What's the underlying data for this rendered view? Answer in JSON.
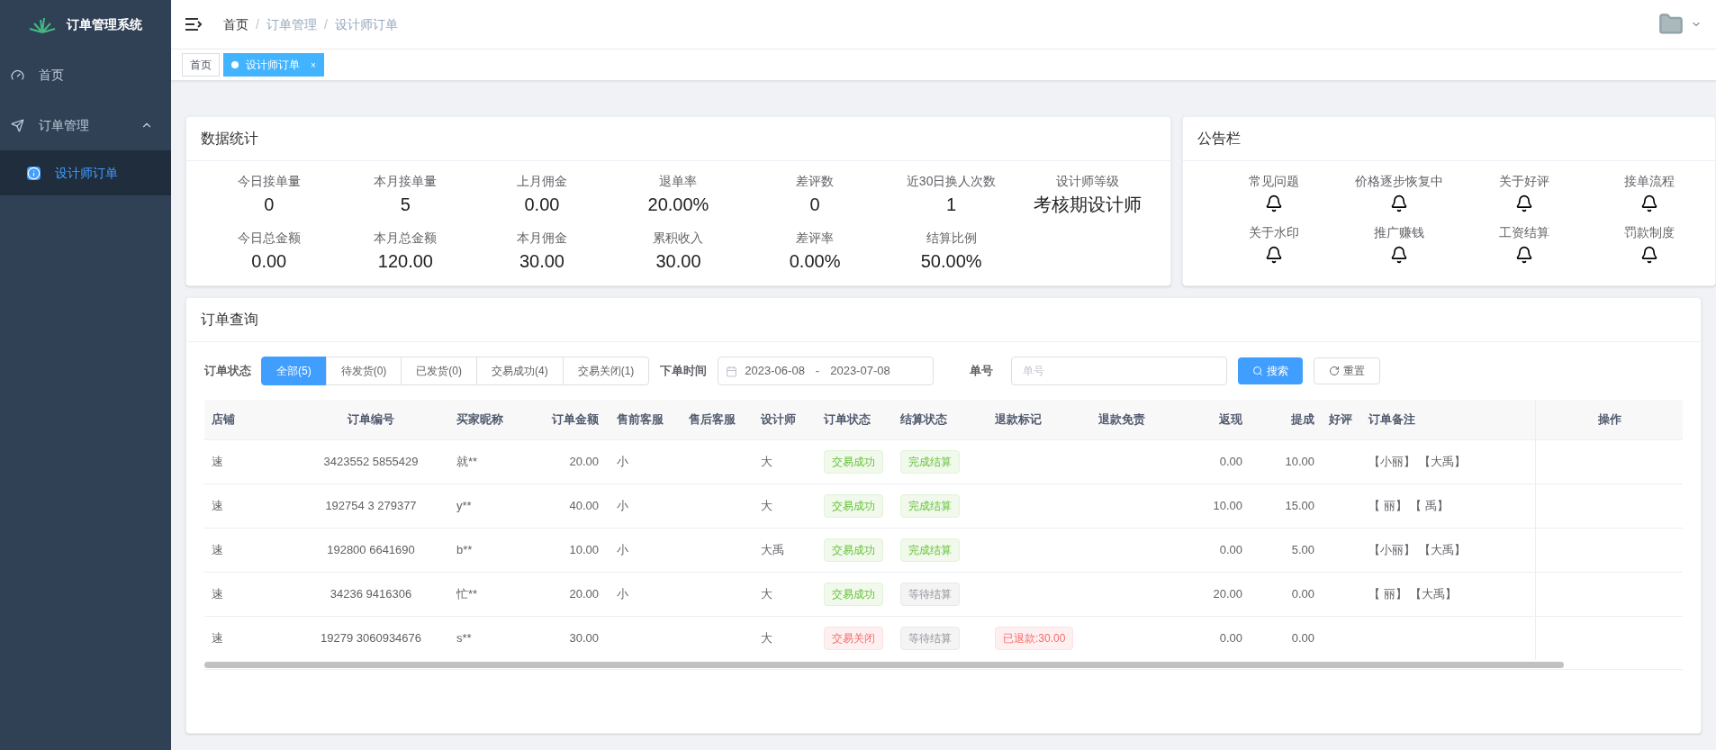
{
  "sidebar": {
    "title": "订单管理系统",
    "items": [
      {
        "label": "首页",
        "selected": false
      },
      {
        "label": "订单管理",
        "expanded": true,
        "selected": false,
        "children": [
          {
            "label": "设计师订单",
            "selected": true
          }
        ]
      }
    ]
  },
  "breadcrumb": {
    "separator": "/",
    "items": [
      "首页",
      "订单管理",
      "设计师订单"
    ]
  },
  "tags": [
    {
      "label": "首页",
      "selected": false,
      "closable": false
    },
    {
      "label": "设计师订单",
      "selected": true,
      "closable": true,
      "close": "×"
    }
  ],
  "stats": {
    "title": "数据统计",
    "items": [
      {
        "label": "今日接单量",
        "value": "0"
      },
      {
        "label": "本月接单量",
        "value": "5"
      },
      {
        "label": "上月佣金",
        "value": "0.00"
      },
      {
        "label": "退单率",
        "value": "20.00%"
      },
      {
        "label": "差评数",
        "value": "0"
      },
      {
        "label": "近30日换人次数",
        "value": "1"
      },
      {
        "label": "设计师等级",
        "value": "考核期设计师"
      },
      {
        "label": "今日总金额",
        "value": "0.00"
      },
      {
        "label": "本月总金额",
        "value": "120.00"
      },
      {
        "label": "本月佣金",
        "value": "30.00"
      },
      {
        "label": "累积收入",
        "value": "30.00"
      },
      {
        "label": "差评率",
        "value": "0.00%"
      },
      {
        "label": "结算比例",
        "value": "50.00%"
      }
    ]
  },
  "notices": {
    "title": "公告栏",
    "items": [
      "常见问题",
      "价格逐步恢复中",
      "关于好评",
      "接单流程",
      "关于水印",
      "推广赚钱",
      "工资结算",
      "罚款制度"
    ]
  },
  "orders": {
    "title": "订单查询",
    "status_label": "订单状态",
    "status_options": [
      {
        "label": "全部(5)",
        "selected": true
      },
      {
        "label": "待发货(0)",
        "selected": false
      },
      {
        "label": "已发货(0)",
        "selected": false
      },
      {
        "label": "交易成功(4)",
        "selected": false
      },
      {
        "label": "交易关闭(1)",
        "selected": false
      }
    ],
    "date_label": "下单时间",
    "date_start": "2023-06-08",
    "date_sep": "-",
    "date_end": "2023-07-08",
    "number_label": "单号",
    "number_placeholder": "单号",
    "search_button": "搜索",
    "reset_button": "重置",
    "columns": [
      "店铺",
      "订单编号",
      "买家昵称",
      "订单金额",
      "售前客服",
      "售后客服",
      "设计师",
      "订单状态",
      "结算状态",
      "退款标记",
      "退款免责",
      "返现",
      "提成",
      "好评",
      "订单备注",
      "操作"
    ],
    "rows": [
      {
        "shop": "速",
        "order_no": "3423552 5855429",
        "buyer": "就**",
        "amount": "20.00",
        "presale": "小",
        "designer": "大",
        "status": {
          "text": "交易成功",
          "kind": "success"
        },
        "settle": {
          "text": "完成结算",
          "kind": "success"
        },
        "cashback": "0.00",
        "commission": "10.00",
        "remark": "【小丽】 【大禹】"
      },
      {
        "shop": "速",
        "order_no": "192754 3 279377",
        "buyer": "y**",
        "amount": "40.00",
        "presale": "小",
        "designer": "大",
        "status": {
          "text": "交易成功",
          "kind": "success"
        },
        "settle": {
          "text": "完成结算",
          "kind": "success"
        },
        "cashback": "10.00",
        "commission": "15.00",
        "remark": "【 丽】 【 禹】"
      },
      {
        "shop": "速",
        "order_no": "192800 6641690",
        "buyer": "b**",
        "amount": "10.00",
        "presale": "小",
        "designer": "大禹",
        "status": {
          "text": "交易成功",
          "kind": "success"
        },
        "settle": {
          "text": "完成结算",
          "kind": "success"
        },
        "cashback": "0.00",
        "commission": "5.00",
        "remark": "【小丽】 【大禹】"
      },
      {
        "shop": "速",
        "order_no": "34236 9416306",
        "buyer": "忙**",
        "amount": "20.00",
        "presale": "小",
        "designer": "大",
        "status": {
          "text": "交易成功",
          "kind": "success"
        },
        "settle": {
          "text": "等待结算",
          "kind": "info"
        },
        "cashback": "20.00",
        "commission": "0.00",
        "remark": "【 丽】 【大禹】"
      },
      {
        "shop": "速",
        "order_no": "19279 3060934676",
        "buyer": "s**",
        "amount": "30.00",
        "designer": "大",
        "status": {
          "text": "交易关闭",
          "kind": "danger"
        },
        "settle": {
          "text": "等待结算",
          "kind": "info"
        },
        "refund": {
          "text": "已退款:30.00",
          "kind": "danger"
        },
        "cashback": "0.00",
        "commission": "0.00"
      }
    ]
  }
}
